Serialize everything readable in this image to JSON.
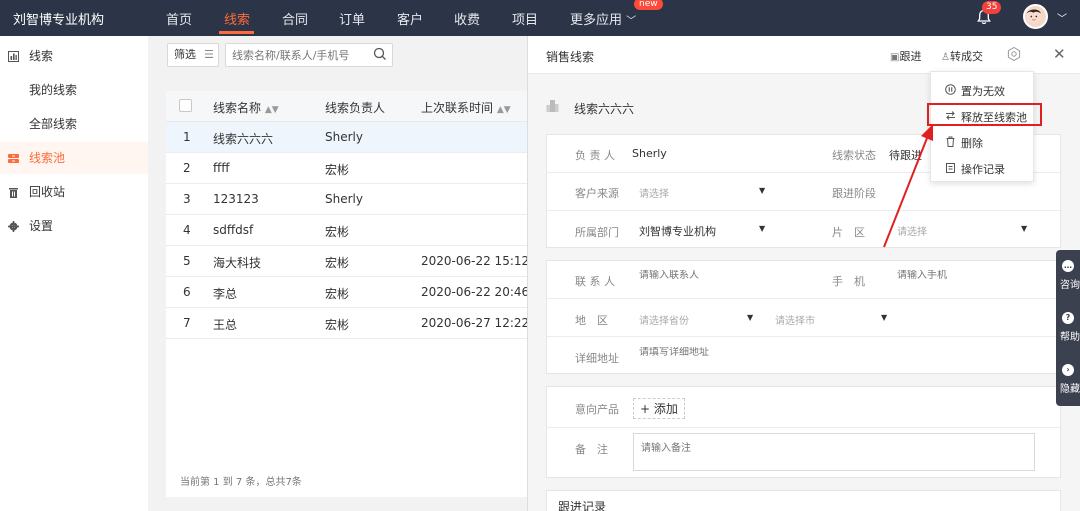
{
  "header": {
    "brand": "刘智博专业机构",
    "nav": [
      "首页",
      "线索",
      "合同",
      "订单",
      "客户",
      "收费",
      "项目",
      "更多应用"
    ],
    "new_badge": "new",
    "notification_count": "35"
  },
  "sidebar": {
    "items": [
      {
        "label": "线索"
      },
      {
        "label": "我的线索"
      },
      {
        "label": "全部线索"
      },
      {
        "label": "线索池"
      },
      {
        "label": "回收站"
      },
      {
        "label": "设置"
      }
    ]
  },
  "toolbar": {
    "filter_label": "筛选",
    "search_placeholder": "线索名称/联系人/手机号"
  },
  "table": {
    "headers": [
      "线索名称",
      "线索负责人",
      "上次联系时间"
    ],
    "rows": [
      {
        "idx": "1",
        "name": "线索六六六",
        "owner": "Sherly",
        "last_contact": ""
      },
      {
        "idx": "2",
        "name": "ffff",
        "owner": "宏彬",
        "last_contact": ""
      },
      {
        "idx": "3",
        "name": "123123",
        "owner": "Sherly",
        "last_contact": ""
      },
      {
        "idx": "4",
        "name": "sdffdsf",
        "owner": "宏彬",
        "last_contact": ""
      },
      {
        "idx": "5",
        "name": "海大科技",
        "owner": "宏彬",
        "last_contact": "2020-06-22 15:12"
      },
      {
        "idx": "6",
        "name": "李总",
        "owner": "宏彬",
        "last_contact": "2020-06-22 20:46"
      },
      {
        "idx": "7",
        "name": "王总",
        "owner": "宏彬",
        "last_contact": "2020-06-27 12:22"
      }
    ],
    "footer": "当前第 1 到 7 条，总共7条"
  },
  "panel": {
    "title": "销售线索",
    "follow_label": "跟进",
    "convert_label": "转成交",
    "lead_name": "线索六六六",
    "fields": {
      "owner_label": "负 责 人",
      "owner_value": "Sherly",
      "status_label": "线索状态",
      "status_value": "待跟进",
      "source_label": "客户来源",
      "source_placeholder": "请选择",
      "stage_label": "跟进阶段",
      "dept_label": "所属部门",
      "dept_value": "刘智博专业机构",
      "area_label": "片　区",
      "area_placeholder": "请选择",
      "contact_label": "联 系 人",
      "contact_placeholder": "请输入联系人",
      "phone_label": "手　机",
      "phone_placeholder": "请输入手机",
      "region_label": "地　区",
      "province_placeholder": "请选择省份",
      "city_placeholder": "请选择市",
      "address_label": "详细地址",
      "address_placeholder": "请填写详细地址",
      "product_label": "意向产品",
      "add_label": "+ 添加",
      "remark_label": "备　注",
      "remark_placeholder": "请输入备注"
    },
    "section_title": "跟进记录"
  },
  "menu": {
    "items": [
      {
        "label": "置为无效"
      },
      {
        "label": "释放至线索池"
      },
      {
        "label": "删除"
      },
      {
        "label": "操作记录"
      }
    ]
  },
  "float_bar": {
    "items": [
      {
        "label": "咨询"
      },
      {
        "label": "帮助"
      },
      {
        "label": "隐藏"
      }
    ]
  },
  "colors": {
    "accent": "#fe6a3a",
    "topbar": "#2c3547",
    "highlight": "#e02020"
  }
}
